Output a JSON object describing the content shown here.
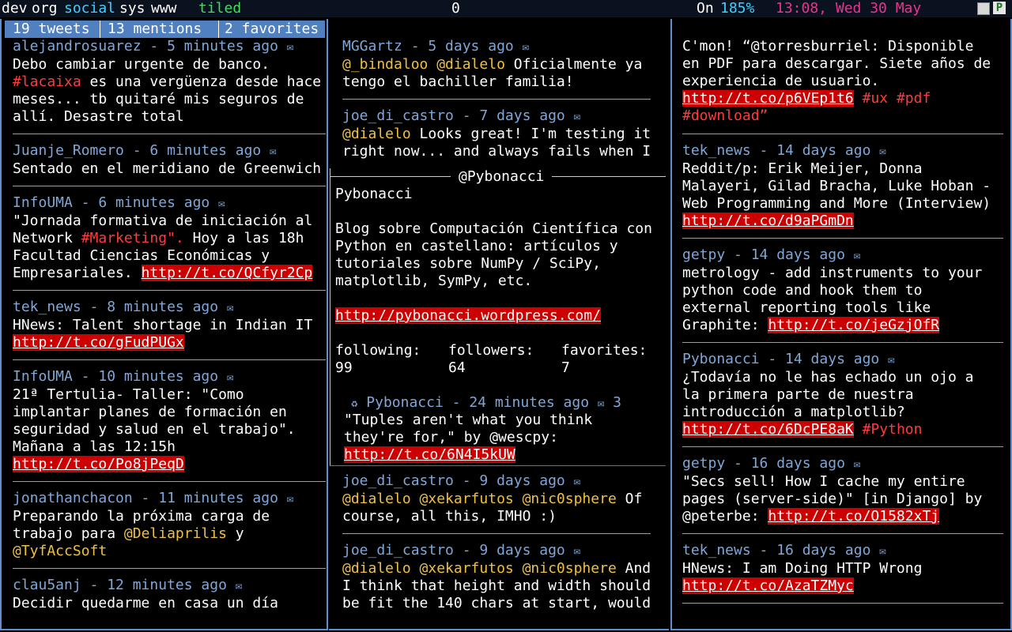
{
  "topbar": {
    "tags": [
      "dev",
      "org",
      "social",
      "sys",
      "www"
    ],
    "layout": "tiled",
    "count": "0",
    "status": "On",
    "battery": "185%",
    "datetime": "13:08, Wed 30 May"
  },
  "tabs": [
    "19 tweets",
    "13 mentions",
    "2 favorites"
  ],
  "colors": {
    "author": "#7fa7d8",
    "highlight": "#f0c040",
    "url_bg": "#cc0000",
    "frame": "#5e8fd0"
  },
  "left": [
    {
      "author": "alejandrosuarez - 5 minutes ago",
      "lines": [
        "Debo cambiar urgente de banco.",
        "#lacaixa es una vergüenza desde hace",
        "meses... tb quitaré mis seguros de",
        "allí. Desastre total"
      ]
    },
    {
      "author": "Juanje_Romero - 6 minutes ago",
      "lines": [
        "Sentado en el meridiano de Greenwich"
      ]
    },
    {
      "author": "InfoUMA - 6 minutes ago",
      "lines": [
        "\"Jornada formativa de iniciación al",
        "Network #Marketing\". Hoy a las 18h",
        "Facultad Ciencias Económicas y",
        "Empresariales. http://t.co/QCfyr2Cp"
      ]
    },
    {
      "author": "tek_news - 8 minutes ago",
      "lines": [
        "HNews: Talent shortage in Indian IT",
        "http://t.co/gFudPUGx"
      ]
    },
    {
      "author": "InfoUMA - 10 minutes ago",
      "lines": [
        "21ª Tertulia- Taller: \"Como",
        "implantar planes de formación en",
        "seguridad y salud en el trabajo\".",
        "Mañana a las 12:15h",
        "http://t.co/Po8jPeqD"
      ]
    },
    {
      "author": "jonathanchacon - 11 minutes ago",
      "lines": [
        "Preparando la próxima carga de",
        "trabajo para @Deliaprilis y",
        "@TyfAccSoft"
      ]
    },
    {
      "author": "clau5anj - 12 minutes ago",
      "lines": [
        "Decidir quedarme en casa un día"
      ]
    }
  ],
  "middle": [
    {
      "author": "MGGartz - 5 days ago",
      "lines": [
        "@_bindaloo @dialelo Oficialmente ya",
        "tengo el bachiller familia!"
      ]
    },
    {
      "author": "joe_di_castro - 7 days ago",
      "lines": [
        "@dialelo Looks great! I'm testing it",
        "right now... and always fails when I"
      ]
    },
    {
      "author": "joe_di_castro - 9 days ago",
      "lines": [
        "@dialelo @xekarfutos @nic0sphere Of",
        "course, all this, IMHO :)"
      ]
    },
    {
      "author": "joe_di_castro - 9 days ago",
      "lines": [
        "@dialelo @xekarfutos @nic0sphere And",
        "I think that height and width should",
        "be fit the 140 chars at start, would"
      ]
    }
  ],
  "popup": {
    "title": "@Pybonacci",
    "name": "Pybonacci",
    "bio": [
      "Blog sobre Computación Científica con",
      "Python en castellano: artículos y",
      "tutoriales sobre NumPy / SciPy,",
      "matplotlib, SymPy, etc."
    ],
    "url": "http://pybonacci.wordpress.com/",
    "following_label": "following:",
    "followers_label": "followers:",
    "favorites_label": "favorites:",
    "following": "99",
    "followers": "64",
    "favorites": "7",
    "tweet_author": "Pybonacci - 24 minutes ago",
    "retweet_count": "3",
    "tweet_lines": [
      "\"Tuples aren't what you think",
      "they're for,\" by @wescpy:",
      "http://t.co/6N4I5kUW"
    ]
  },
  "right": [
    {
      "author": "",
      "lines": [
        "C'mon! “@torresburriel: Disponible",
        "en PDF para descargar. Siete años de",
        "experiencia de usuario.",
        "http://t.co/p6VEp1t6 #ux #pdf",
        "#download”"
      ]
    },
    {
      "author": "tek_news - 14 days ago",
      "lines": [
        "Reddit/p: Erik Meijer, Donna",
        "Malayeri, Gilad Bracha, Luke Hoban -",
        "Web Programming and More (Interview)",
        "http://t.co/d9aPGmDn"
      ]
    },
    {
      "author": "getpy - 14 days ago",
      "lines": [
        "metrology - add instruments to your",
        "python code and hook them to",
        "external reporting tools like",
        "Graphite: http://t.co/jeGzjOfR"
      ]
    },
    {
      "author": "Pybonacci - 14 days ago",
      "lines": [
        "¿Todavía no le has echado un ojo a",
        "la primera parte de nuestra",
        "introducción a matplotlib?",
        "http://t.co/6DcPE8aK #Python"
      ]
    },
    {
      "author": "getpy - 16 days ago",
      "lines": [
        "\"Secs sell! How I cache my entire",
        "pages (server-side)\" [in Django] by",
        "@peterbe: http://t.co/O1582xTj"
      ]
    },
    {
      "author": "tek_news - 16 days ago",
      "lines": [
        "HNews: I am Doing HTTP Wrong",
        "http://t.co/AzaTZMyc"
      ]
    }
  ]
}
